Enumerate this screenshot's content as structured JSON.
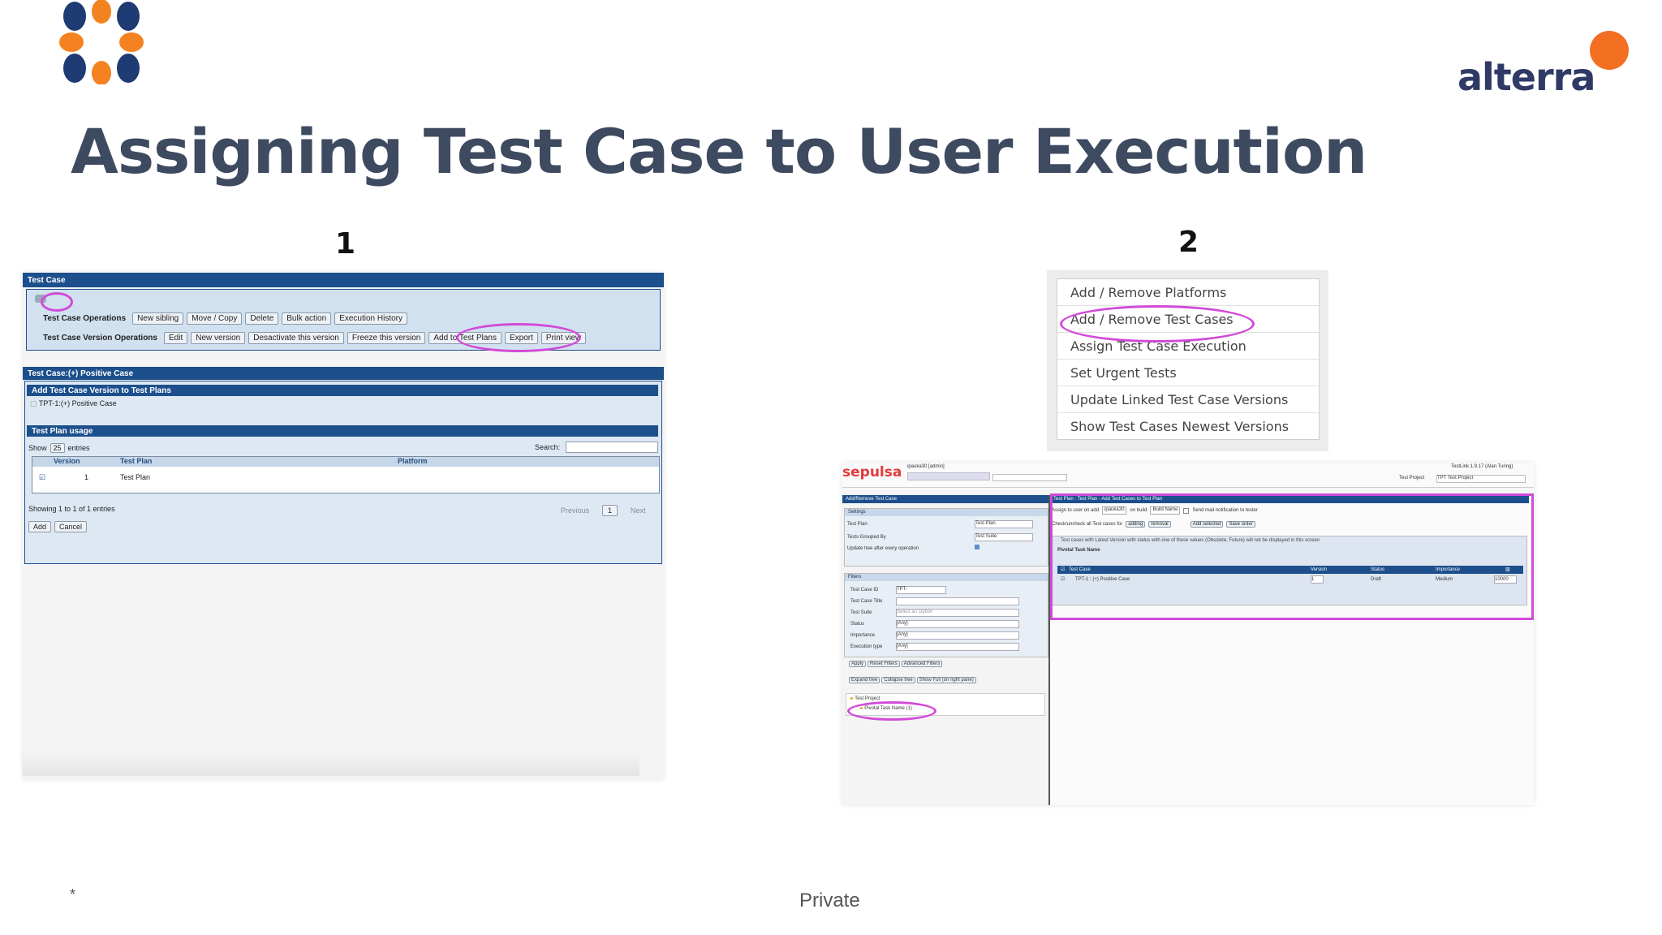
{
  "slide": {
    "title": "Assigning Test Case to User Execution",
    "step1_label": "1",
    "step2_label": "2",
    "footer_left": "*",
    "footer_center": "Private",
    "brand": "alterra",
    "colors": {
      "title": "#3e4a5f",
      "accent_orange": "#f36f21",
      "brand_navy": "#2f3a66",
      "highlight_circle": "#d24ad8",
      "testlink_blue": "#1c4f8c"
    }
  },
  "shot1": {
    "header_title": "Test Case",
    "ops_label": "Test Case Operations",
    "ops_buttons": [
      "New sibling",
      "Move / Copy",
      "Delete",
      "Bulk action",
      "Execution History"
    ],
    "version_ops_label": "Test Case Version Operations",
    "version_buttons": [
      "Edit",
      "New version",
      "Desactivate this version",
      "Freeze this version",
      "Add to Test Plans",
      "Export",
      "Print view"
    ],
    "panel_title": "Test Case:(+) Positive Case",
    "add_section_title": "Add Test Case Version to Test Plans",
    "tc_item": "TPT-1:(+) Positive Case",
    "usage_title": "Test Plan usage",
    "show_label": "Show",
    "show_value": "25",
    "entries_label": "entries",
    "search_label": "Search:",
    "columns": [
      "Version",
      "Test Plan",
      "Platform"
    ],
    "rows": [
      {
        "version": "1",
        "test_plan": "Test Plan",
        "platform": ""
      }
    ],
    "showing": "Showing 1 to 1 of 1 entries",
    "previous": "Previous",
    "page": "1",
    "next": "Next",
    "add_button": "Add",
    "cancel_button": "Cancel"
  },
  "menu2": {
    "items": [
      "Add / Remove Platforms",
      "Add / Remove Test Cases",
      "Assign Test Case Execution",
      "Set Urgent Tests",
      "Update Linked Test Case Versions",
      "Show Test Cases Newest Versions"
    ]
  },
  "shot2": {
    "logo": "sepulsa",
    "user": "ipauka30 [admin]",
    "version": "TestLink 1.9.17 (Alan Turing)",
    "project_label": "Test Project",
    "project_value": "TPT Test Project",
    "left_title": "Add/Remove Test Case",
    "settings": "Settings",
    "test_plan_label": "Test Plan",
    "test_plan_value": "Test Plan",
    "grouped_label": "Tests Grouped By",
    "grouped_value": "Test Suite",
    "update_label": "Update tree after every operation",
    "filters": "Filters",
    "filter_labels": [
      "Test Case ID",
      "Test Case Title",
      "Test Suite",
      "Status",
      "Importance",
      "Execution type"
    ],
    "filter_values": [
      "TPT-",
      "",
      "Select an Option",
      "[Any]",
      "[Any]",
      "[Any]"
    ],
    "filter_buttons": [
      "Apply",
      "Reset Filters",
      "Advanced Filters"
    ],
    "tree_buttons": [
      "Expand tree",
      "Collapse tree",
      "Show Full (on right pane)"
    ],
    "tree_root": "Test Project",
    "tree_child": "Pivotal Task Name (1)",
    "right_title": "Test Plan : Test Plan - Add Test Cases to Test Plan",
    "assign_text": "Assign to user on add",
    "assign_user": "ipauka30",
    "build_label": "on build",
    "build_value": "Build Name",
    "send_mail": "Send mail notification to tester",
    "check_text": "Check/uncheck all Test cases for",
    "check_buttons": [
      "adding",
      "removal"
    ],
    "action_buttons": [
      "Add selected",
      "Save order"
    ],
    "notice": "Test cases with Latest Version with status with one of these values (Obsolete, Future) will not be displayed in this screen",
    "suite_name": "Pivotal Task Name",
    "table_headers": [
      "Test Case",
      "Version",
      "Status",
      "Importance"
    ],
    "row": {
      "name": "TPT-1 : (+) Positive Case",
      "version": "1",
      "status": "Draft",
      "importance": "Medium",
      "order": "10000"
    }
  }
}
